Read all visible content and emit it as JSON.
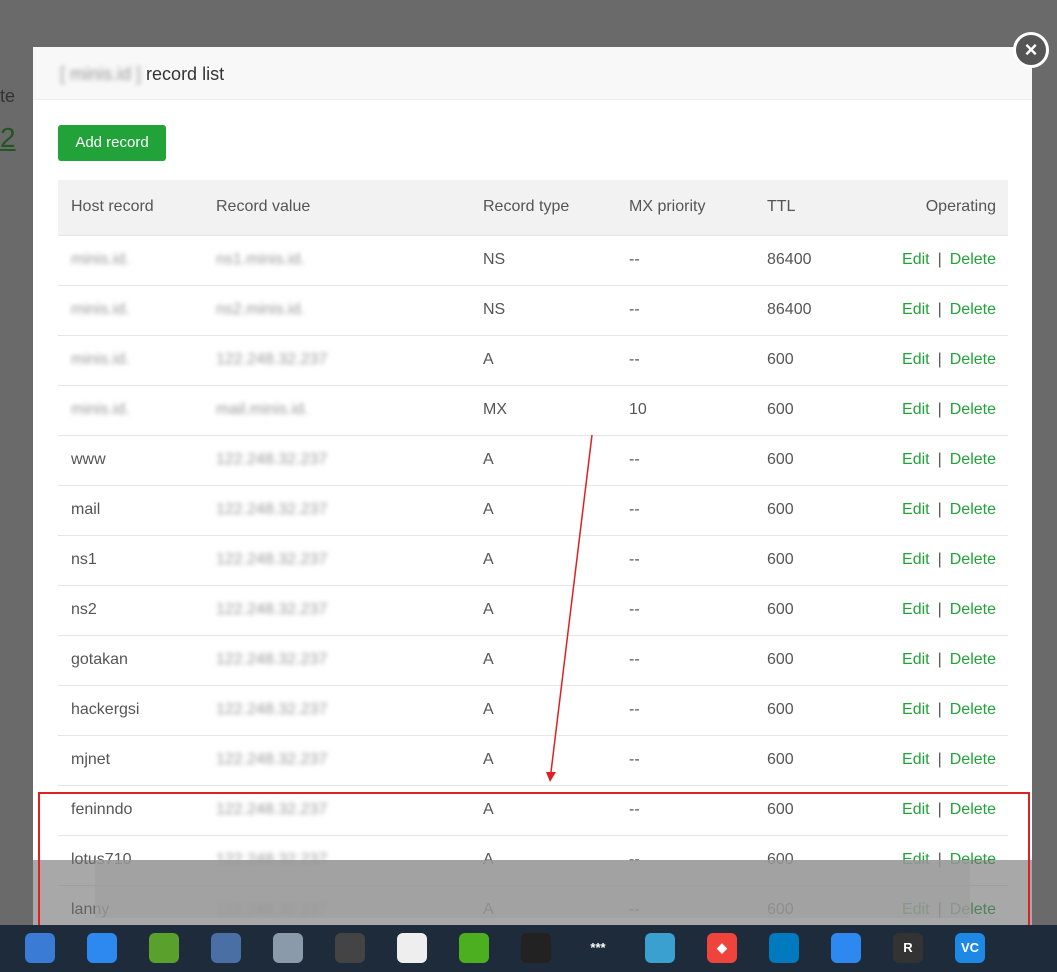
{
  "background": {
    "label_fragment": "te",
    "number_fragment": "2"
  },
  "modal": {
    "title_domain": "[ minis.id ]",
    "title": "record list",
    "add_button": "Add record"
  },
  "table": {
    "headers": [
      "Host record",
      "Record value",
      "Record type",
      "MX priority",
      "TTL",
      "Operating"
    ],
    "edit_label": "Edit",
    "delete_label": "Delete",
    "separator": "|",
    "rows": [
      {
        "host": "minis.id.",
        "value": "ns1.minis.id.",
        "type": "NS",
        "mx": "--",
        "ttl": "86400"
      },
      {
        "host": "minis.id.",
        "value": "ns2.minis.id.",
        "type": "NS",
        "mx": "--",
        "ttl": "86400"
      },
      {
        "host": "minis.id.",
        "value": "122.248.32.237",
        "type": "A",
        "mx": "--",
        "ttl": "600"
      },
      {
        "host": "minis.id.",
        "value": "mail.minis.id.",
        "type": "MX",
        "mx": "10",
        "ttl": "600"
      },
      {
        "host": "www",
        "value": "122.248.32.237",
        "type": "A",
        "mx": "--",
        "ttl": "600"
      },
      {
        "host": "mail",
        "value": "122.248.32.237",
        "type": "A",
        "mx": "--",
        "ttl": "600"
      },
      {
        "host": "ns1",
        "value": "122.248.32.237",
        "type": "A",
        "mx": "--",
        "ttl": "600"
      },
      {
        "host": "ns2",
        "value": "122.248.32.237",
        "type": "A",
        "mx": "--",
        "ttl": "600"
      },
      {
        "host": "gotakan",
        "value": "122.248.32.237",
        "type": "A",
        "mx": "--",
        "ttl": "600"
      },
      {
        "host": "hackergsi",
        "value": "122.248.32.237",
        "type": "A",
        "mx": "--",
        "ttl": "600"
      },
      {
        "host": "mjnet",
        "value": "122.248.32.237",
        "type": "A",
        "mx": "--",
        "ttl": "600"
      },
      {
        "host": "feninndo",
        "value": "122.248.32.237",
        "type": "A",
        "mx": "--",
        "ttl": "600"
      },
      {
        "host": "lotus710",
        "value": "122.248.32.237",
        "type": "A",
        "mx": "--",
        "ttl": "600"
      },
      {
        "host": "lanny",
        "value": "122.248.32.237",
        "type": "A",
        "mx": "--",
        "ttl": "600"
      }
    ]
  },
  "taskbar": {
    "icons": [
      {
        "name": "thunderbird-icon",
        "color": "#3a7bd5",
        "glyph": ""
      },
      {
        "name": "browser-icon",
        "color": "#2d89ef",
        "glyph": ""
      },
      {
        "name": "notepad-icon",
        "color": "#5aa02c",
        "glyph": ""
      },
      {
        "name": "keepass-icon",
        "color": "#4a6fa5",
        "glyph": ""
      },
      {
        "name": "cloud-icon",
        "color": "#8a9aaa",
        "glyph": ""
      },
      {
        "name": "photoscape-icon",
        "color": "#444",
        "glyph": ""
      },
      {
        "name": "calculator-icon",
        "color": "#eee",
        "glyph": ""
      },
      {
        "name": "app-green-icon",
        "color": "#4caf20",
        "glyph": ""
      },
      {
        "name": "speedtest-icon",
        "color": "#222",
        "glyph": ""
      },
      {
        "name": "password-icon",
        "color": "#1d2b3b",
        "glyph": "***"
      },
      {
        "name": "paint-icon",
        "color": "#3aa0d0",
        "glyph": ""
      },
      {
        "name": "anydesk-icon",
        "color": "#ef443b",
        "glyph": "◆"
      },
      {
        "name": "trello-icon",
        "color": "#0079bf",
        "glyph": ""
      },
      {
        "name": "remote-desktop-icon",
        "color": "#2d89ef",
        "glyph": ""
      },
      {
        "name": "rstudio-icon",
        "color": "#333",
        "glyph": "R"
      },
      {
        "name": "vnc-icon",
        "color": "#1e88e5",
        "glyph": "VC"
      }
    ]
  }
}
